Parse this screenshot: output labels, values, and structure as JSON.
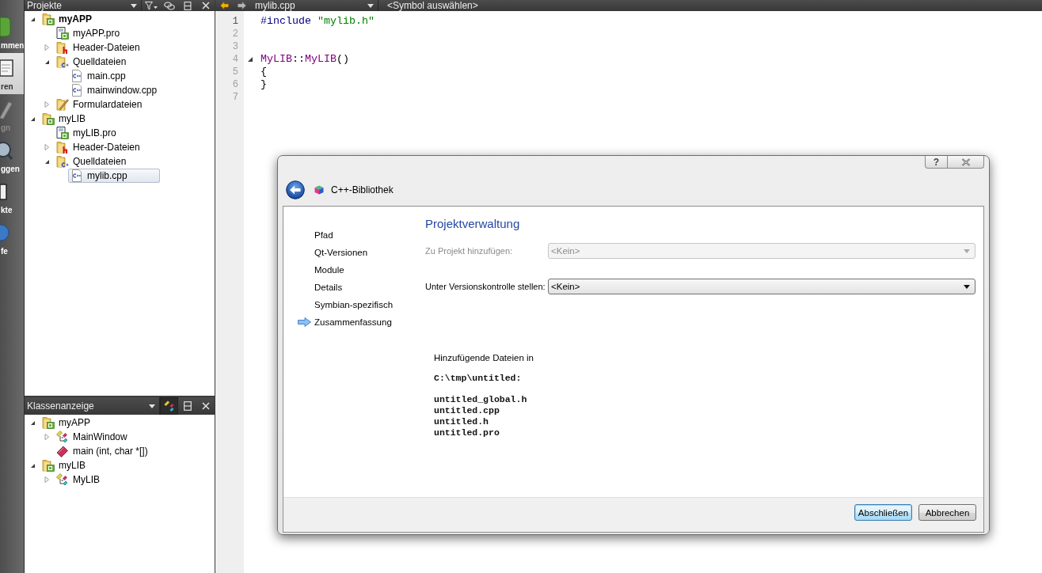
{
  "mode_bar": {
    "items": [
      {
        "kind": "welcome",
        "label": "mmen",
        "selected": false,
        "disabled": false
      },
      {
        "kind": "edit",
        "label": "ren",
        "selected": true,
        "disabled": false
      },
      {
        "kind": "design",
        "label": "gn",
        "selected": false,
        "disabled": true
      },
      {
        "kind": "debug",
        "label": "ggen",
        "selected": false,
        "disabled": false
      },
      {
        "kind": "projects",
        "label": "kte",
        "selected": false,
        "disabled": false
      },
      {
        "kind": "help",
        "label": "fe",
        "selected": false,
        "disabled": false
      }
    ]
  },
  "projects_panel": {
    "title": "Projekte",
    "tree": [
      {
        "kind": "project",
        "label": "myAPP",
        "active": true,
        "expanded": true,
        "selected": false,
        "children": [
          {
            "kind": "pro-file",
            "label": "myAPP.pro",
            "selected": false
          },
          {
            "kind": "header-folder",
            "label": "Header-Dateien",
            "expanded": false,
            "selected": false
          },
          {
            "kind": "source-folder",
            "label": "Quelldateien",
            "expanded": true,
            "selected": false,
            "children": [
              {
                "kind": "cpp-file",
                "label": "main.cpp",
                "selected": false
              },
              {
                "kind": "cpp-file",
                "label": "mainwindow.cpp",
                "selected": false
              }
            ]
          },
          {
            "kind": "form-folder",
            "label": "Formulardateien",
            "expanded": false,
            "selected": false
          }
        ]
      },
      {
        "kind": "project",
        "label": "myLIB",
        "active": false,
        "expanded": true,
        "selected": false,
        "children": [
          {
            "kind": "pro-file",
            "label": "myLIB.pro",
            "selected": false
          },
          {
            "kind": "header-folder",
            "label": "Header-Dateien",
            "expanded": false,
            "selected": false
          },
          {
            "kind": "source-folder",
            "label": "Quelldateien",
            "expanded": true,
            "selected": false,
            "children": [
              {
                "kind": "cpp-file",
                "label": "mylib.cpp",
                "selected": true
              }
            ]
          }
        ]
      }
    ]
  },
  "class_panel": {
    "title": "Klassenanzeige",
    "sync_on": true,
    "tree": [
      {
        "kind": "project",
        "label": "myAPP",
        "expanded": true,
        "selected": false,
        "children": [
          {
            "kind": "class",
            "label": "MainWindow",
            "expanded": false,
            "selected": false
          },
          {
            "kind": "function",
            "label": "main (int, char *[])",
            "selected": false
          }
        ]
      },
      {
        "kind": "project",
        "label": "myLIB",
        "expanded": true,
        "selected": false,
        "children": [
          {
            "kind": "class",
            "label": "MyLIB",
            "expanded": false,
            "selected": false
          }
        ]
      }
    ]
  },
  "editor": {
    "file": "mylib.cpp",
    "symbol": "<Symbol auswählen>",
    "lines": [
      {
        "number": "1",
        "current": true,
        "fold": false,
        "tokens": [
          {
            "kind": "preprocessor",
            "text": "#include "
          },
          {
            "kind": "string",
            "text": "\"mylib.h\""
          }
        ]
      },
      {
        "number": "2",
        "current": false,
        "fold": false
      },
      {
        "number": "3",
        "current": false,
        "fold": false
      },
      {
        "number": "4",
        "current": false,
        "fold": true,
        "tokens": [
          {
            "kind": "type",
            "text": "MyLIB"
          },
          {
            "kind": "plain",
            "text": "::"
          },
          {
            "kind": "type",
            "text": "MyLIB"
          },
          {
            "kind": "plain",
            "text": "()"
          }
        ]
      },
      {
        "number": "5",
        "current": false,
        "fold": false,
        "tokens": [
          {
            "kind": "plain",
            "text": "{"
          }
        ]
      },
      {
        "number": "6",
        "current": false,
        "fold": false,
        "tokens": [
          {
            "kind": "plain",
            "text": "}"
          }
        ]
      },
      {
        "number": "7",
        "current": false,
        "fold": false
      }
    ]
  },
  "dialog": {
    "help_button": "?",
    "title": "C++-Bibliothek",
    "steps": [
      {
        "label": "Pfad",
        "selected": false
      },
      {
        "label": "Qt-Versionen",
        "selected": false
      },
      {
        "label": "Module",
        "selected": false
      },
      {
        "label": "Details",
        "selected": false
      },
      {
        "label": "Symbian-spezifisch",
        "selected": false
      },
      {
        "label": "Zusammenfassung",
        "selected": true
      }
    ],
    "page_title": "Projektverwaltung",
    "fields": [
      {
        "label": "Zu Projekt hinzufügen:",
        "value": "<Kein>",
        "disabled": true
      },
      {
        "label": "Unter Versionskontrolle stellen:",
        "value": "<Kein>",
        "disabled": false
      }
    ],
    "summary": {
      "heading": "Hinzufügende Dateien in",
      "directory": "C:\\tmp\\untitled:",
      "files": [
        "untitled_global.h",
        "untitled.cpp",
        "untitled.h",
        "untitled.pro"
      ]
    },
    "buttons": [
      {
        "label": "Abschließen",
        "default": true
      },
      {
        "label": "Abbrechen",
        "default": false
      }
    ]
  }
}
